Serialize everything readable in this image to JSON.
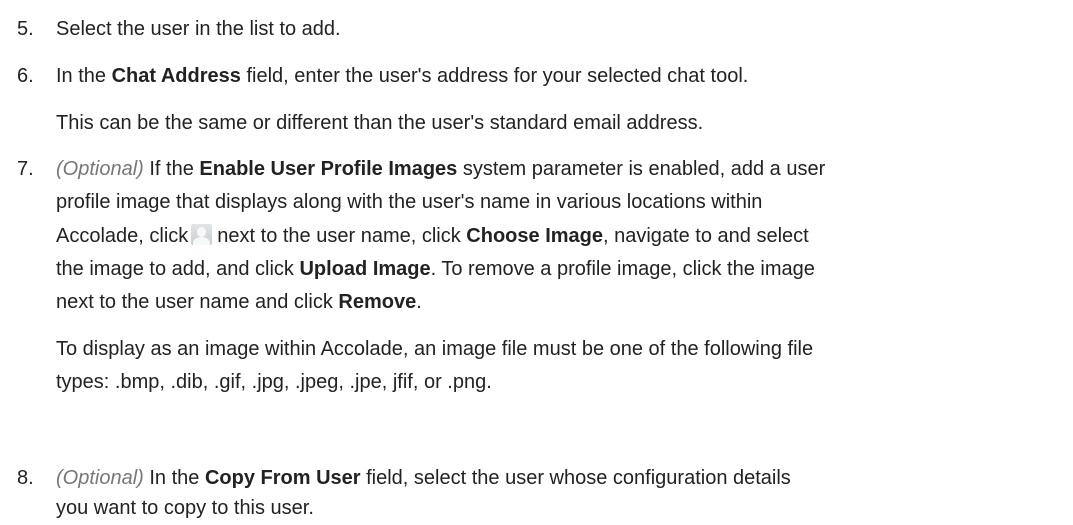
{
  "steps": [
    {
      "number": "5.",
      "text": "Select the user in the list to add."
    },
    {
      "number": "6.",
      "p1_a": "In the ",
      "p1_b": "Chat Address",
      "p1_c": " field, enter the user's address for your selected chat tool.",
      "p2": "This can be the same or different than the user's standard email address."
    },
    {
      "number": "7.",
      "optional": "(Optional)",
      "l1_a": " If the ",
      "l1_b": "Enable User Profile Images",
      "l1_c": " system parameter is enabled, add a user",
      "l2": "profile image that displays along with the user's name in various locations within",
      "l3_a": "Accolade, click",
      "icon": "user-profile-icon",
      "l3_b": "next to the user name, click ",
      "l3_c": "Choose Image",
      "l3_d": ", navigate to and select",
      "l4_a": "the image to add, and click ",
      "l4_b": "Upload Image",
      "l4_c": ". To remove a profile image, click the image",
      "l5_a": "next to the user name and click ",
      "l5_b": "Remove",
      "l5_c": ".",
      "p2_l1": "To display as an image within Accolade, an image file must be one of the following file",
      "p2_l2": "types: .bmp, .dib, .gif, .jpg, .jpeg, .jpe, jfif, or .png."
    },
    {
      "number": "8.",
      "optional": "(Optional)",
      "l1_a": " In the ",
      "l1_b": "Copy From User",
      "l1_c": " field, select the user whose configuration details",
      "l2": "you want to copy to this user."
    }
  ]
}
